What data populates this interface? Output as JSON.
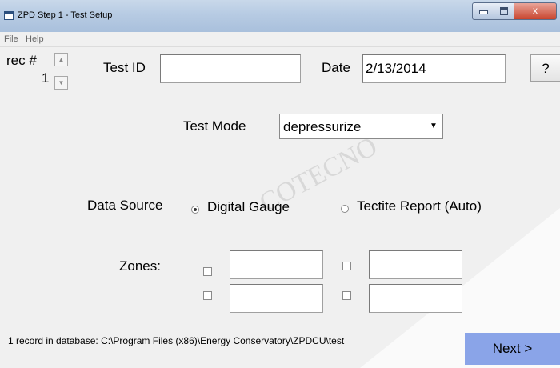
{
  "window": {
    "title": "ZPD Step 1 - Test Setup",
    "min_symbol": "",
    "max_symbol": "",
    "close_symbol": "x"
  },
  "menu": {
    "items": [
      {
        "label": "File"
      },
      {
        "label": "Help"
      }
    ]
  },
  "record": {
    "label": "rec #",
    "value": "1",
    "up_arrow": "▲",
    "down_arrow": "▼"
  },
  "test_id": {
    "label": "Test ID",
    "value": ""
  },
  "date": {
    "label": "Date",
    "value": "2/13/2014"
  },
  "help_button": {
    "label": "?"
  },
  "test_mode": {
    "label": "Test Mode",
    "selected": "depressurize",
    "arrow": "▼"
  },
  "data_source": {
    "label": "Data Source",
    "options": [
      {
        "label": "Digital Gauge",
        "checked": true
      },
      {
        "label": "Tectite Report (Auto)",
        "checked": false
      }
    ]
  },
  "zones": {
    "label": "Zones:",
    "fields": [
      {
        "checked": false,
        "value": ""
      },
      {
        "checked": false,
        "value": ""
      },
      {
        "checked": false,
        "value": ""
      },
      {
        "checked": false,
        "value": ""
      }
    ]
  },
  "status": {
    "text": "1 record in database: C:\\Program Files (x86)\\Energy Conservatory\\ZPDCU\\test"
  },
  "next_button": {
    "label": "Next >"
  },
  "watermark": {
    "text": "COTECNO"
  },
  "colors": {
    "next_button": "#8aa4e8",
    "titlebar": "#b7cbe3",
    "close_button": "#c8452e"
  }
}
